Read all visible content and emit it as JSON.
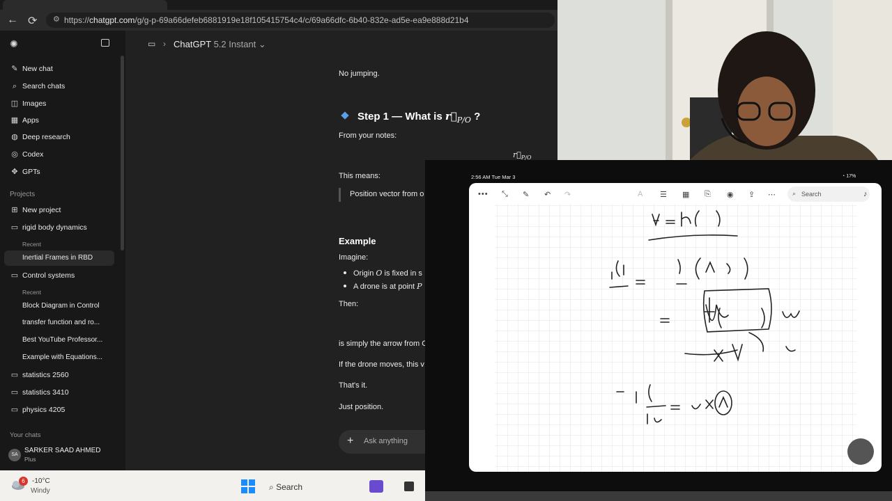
{
  "browser": {
    "url_prefix": "https://",
    "url_host": "chatgpt.com",
    "url_path": "/g/g-p-69a66defeb6881919e18f105415754c4/c/69a66dfc-6b40-832e-ad5e-ea9e888d21b4"
  },
  "header": {
    "model_name": "ChatGPT",
    "model_version": "5.2 Instant"
  },
  "sidebar": {
    "nav": [
      {
        "label": "New chat",
        "icon": "new-chat-icon"
      },
      {
        "label": "Search chats",
        "icon": "search-icon"
      },
      {
        "label": "Images",
        "icon": "image-icon"
      },
      {
        "label": "Apps",
        "icon": "apps-icon"
      },
      {
        "label": "Deep research",
        "icon": "globe-icon"
      },
      {
        "label": "Codex",
        "icon": "codex-icon"
      },
      {
        "label": "GPTs",
        "icon": "gpts-icon"
      }
    ],
    "projects_header": "Projects",
    "new_project": "New project",
    "project_rbd": "rigid body dynamics",
    "recent_label_1": "Recent",
    "rbd_chat": "Inertial Frames in RBD",
    "project_control": "Control systems",
    "recent_label_2": "Recent",
    "control_chats": [
      "Block Diagram in Control",
      "transfer function and ro...",
      "Best YouTube Professor...",
      "Example with Equations..."
    ],
    "other_projects": [
      "statistics 2560",
      "statistics 3410",
      "physics 4205"
    ],
    "your_chats_header": "Your chats",
    "user_name": "SARKER SAAD AHMED",
    "user_plan": "Plus",
    "user_initials": "SA"
  },
  "chat": {
    "line_no_jumping": "No jumping.",
    "step1_title": "Step 1 — What is ",
    "step1_symbol": "r⃗",
    "step1_sub": "P/O",
    "step1_q": " ?",
    "from_notes": "From your notes:",
    "formula_display": "r⃗",
    "formula_sub": "P/O",
    "this_means": "This means:",
    "quote": "Position vector from o",
    "example_heading": "Example",
    "imagine": "Imagine:",
    "bullet1_pre": "Origin ",
    "bullet1_sym": "O",
    "bullet1_post": " is fixed in s",
    "bullet2_pre": "A drone is at point ",
    "bullet2_sym": "P",
    "then": "Then:",
    "simply_arrow": "is simply the arrow from O",
    "drone_moves": "If the drone moves, this v",
    "thats_it": "That's it.",
    "just_position": "Just position.",
    "ask_placeholder": "Ask anything"
  },
  "taskbar": {
    "weather_badge": "6",
    "temperature": "-10°C",
    "weather": "Windy",
    "search_label": "Search"
  },
  "tablet": {
    "status_time": "2:56 AM  Tue Mar 3",
    "status_right": "17%",
    "search_placeholder": "Search"
  }
}
